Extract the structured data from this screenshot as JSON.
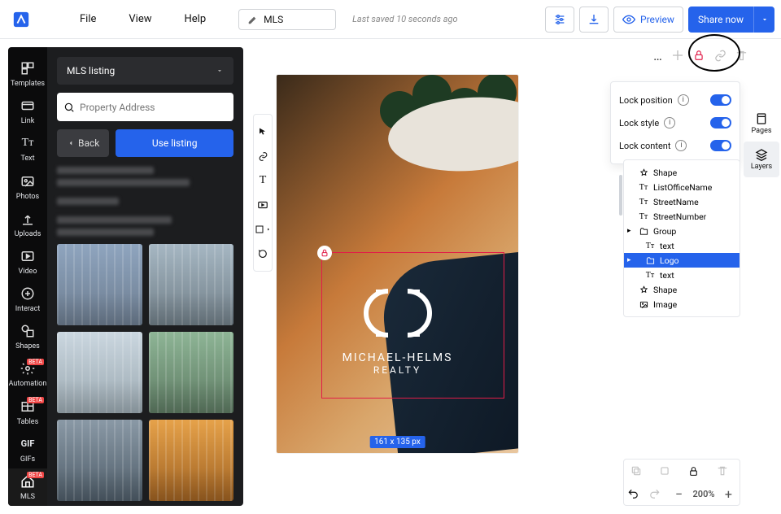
{
  "topbar": {
    "menus": {
      "file": "File",
      "view": "View",
      "help": "Help"
    },
    "doc_name": "MLS",
    "save_status": "Last saved 10 seconds ago",
    "preview": "Preview",
    "share": "Share now"
  },
  "rail": {
    "templates": "Templates",
    "link": "Link",
    "text": "Text",
    "photos": "Photos",
    "uploads": "Uploads",
    "video": "Video",
    "interact": "Interact",
    "shapes": "Shapes",
    "automation": "Automation",
    "tables": "Tables",
    "gifs": "GIFs",
    "mls": "MLS",
    "beta": "BETA"
  },
  "panel": {
    "dropdown": "MLS listing",
    "search_placeholder": "Property Address",
    "back": "Back",
    "use": "Use listing"
  },
  "canvas": {
    "brand_line1": "MICHAEL-HELMS",
    "brand_line2": "REALTY",
    "size_badge": "161 x 135 px"
  },
  "lock_popover": {
    "position": "Lock position",
    "style": "Lock style",
    "content": "Lock content"
  },
  "right_rail": {
    "pages": "Pages",
    "layers": "Layers"
  },
  "layers": {
    "items": [
      {
        "type": "shape",
        "label": "Shape"
      },
      {
        "type": "text",
        "label": "ListOfficeName"
      },
      {
        "type": "text",
        "label": "StreetName"
      },
      {
        "type": "text",
        "label": "StreetNumber"
      },
      {
        "type": "group",
        "label": "Group",
        "expandable": true
      },
      {
        "type": "text",
        "label": "text",
        "indent": true
      },
      {
        "type": "group",
        "label": "Logo",
        "expandable": true,
        "indent": true,
        "selected": true
      },
      {
        "type": "text",
        "label": "text",
        "indent": true
      },
      {
        "type": "shape",
        "label": "Shape"
      },
      {
        "type": "image",
        "label": "Image"
      }
    ]
  },
  "bottom": {
    "zoom": "200%"
  }
}
